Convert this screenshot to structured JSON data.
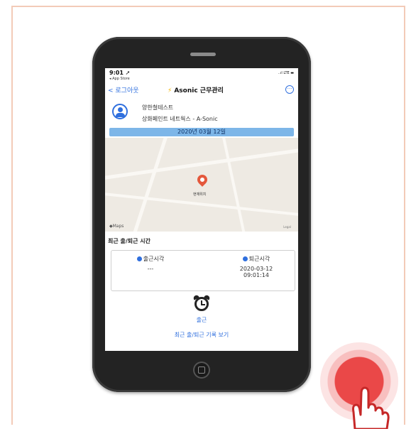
{
  "status_bar": {
    "time": "9:01 ➚",
    "back_app": "◂ App Store",
    "indicators": "..ıl LTE ▬"
  },
  "nav": {
    "back_label": "< 로그아웃",
    "title": "Asonic 근무관리",
    "menu_icon": "ellipsis-circle-icon"
  },
  "profile": {
    "name": "양한철테스트",
    "company": "상화페인트 네트웍스 - A-Sonic"
  },
  "date_banner": "2020년 03월 12일",
  "map": {
    "location_label": "현재위치",
    "logo": "◆Maps",
    "legal": "Legal"
  },
  "recent": {
    "section_title": "최근 출/퇴근 시간",
    "clock_in_label": "출근시각",
    "clock_in_value": "---",
    "clock_out_label": "퇴근시각",
    "clock_out_date": "2020-03-12",
    "clock_out_time": "09:01:14"
  },
  "action": {
    "clock_icon": "alarm-clock-icon",
    "label": "출근",
    "history_link": "최근 출/퇴근 기록 보기"
  },
  "colors": {
    "accent": "#2f6fde",
    "date_banner": "#7db6e8",
    "touch": "#ea4848",
    "frame": "#f3cbb8"
  }
}
